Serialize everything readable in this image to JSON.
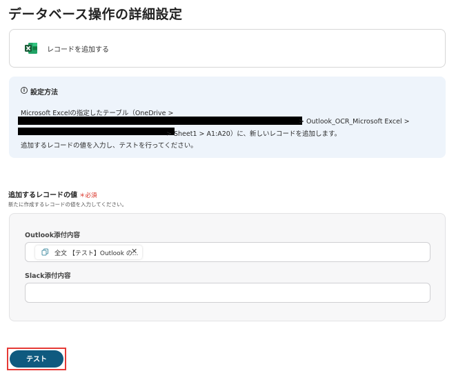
{
  "page": {
    "title": "データベース操作の詳細設定"
  },
  "action": {
    "icon": "excel-icon",
    "label": "レコードを追加する",
    "accent": "#1d6f42"
  },
  "info": {
    "title": "設定方法",
    "line1": "Microsoft Excelの指定したテーブル（OneDrive >",
    "line2_suffix": "> Outlook_OCR_Microsoft Excel >",
    "line3_suffix": "> Sheet1 > A1:A20）に、新しいレコードを追加します。",
    "line4": "追加するレコードの値を入力し、テストを行ってください。",
    "background": "#eef4fb"
  },
  "record_values": {
    "label": "追加するレコードの値",
    "required": "＊必須",
    "description": "新たに作成するレコードの値を入力してください。",
    "fields": [
      {
        "label": "Outlook添付内容",
        "chip": {
          "icon": "copy-icon",
          "text": "全文 【テスト】Outlook の..."
        }
      },
      {
        "label": "Slack添付内容",
        "value": ""
      }
    ]
  },
  "test_button": {
    "label": "テスト",
    "color": "#0f5a7f",
    "highlight": "#e53935"
  }
}
